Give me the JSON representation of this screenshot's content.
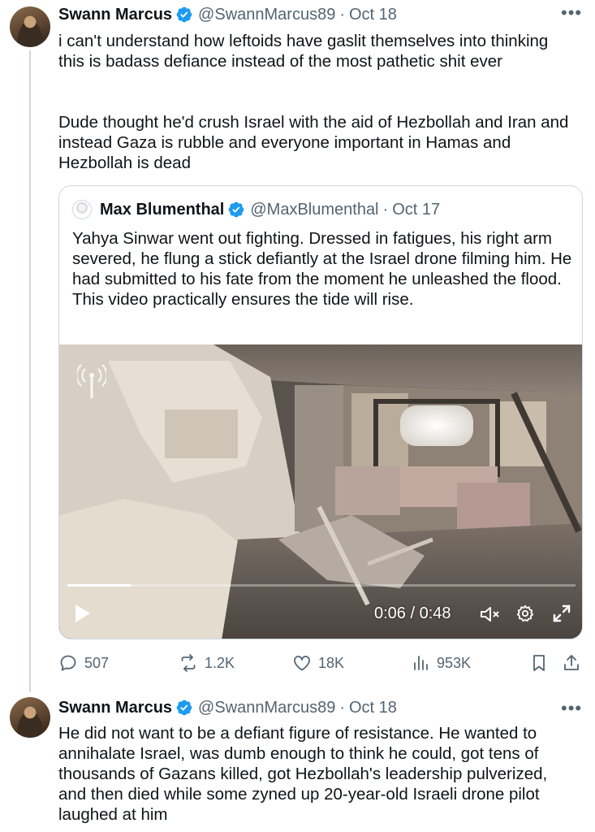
{
  "tweet1": {
    "author_name": "Swann Marcus",
    "handle": "@SwannMarcus89",
    "separator": "·",
    "date": "Oct 18",
    "paragraph1": "i can't understand how leftoids have gaslit themselves into thinking this is badass defiance instead of the most pathetic shit ever",
    "paragraph2": "Dude thought he'd crush Israel with the aid of Hezbollah and Iran and instead Gaza is rubble and everyone important in Hamas and Hezbollah is dead",
    "more_glyph": "•••"
  },
  "quote": {
    "author_name": "Max Blumenthal",
    "handle": "@MaxBlumenthal",
    "separator": "·",
    "date": "Oct 17",
    "text": "Yahya Sinwar went out fighting. Dressed in fatigues, his right arm severed, he flung a stick defiantly at the Israel drone filming him. He had submitted to his fate from the moment he unleashed the flood. This video practically ensures the tide will rise.",
    "video": {
      "timecode": "0:06 / 0:48",
      "progress_fraction": 0.125
    }
  },
  "actions": {
    "replies": "507",
    "retweets": "1.2K",
    "likes": "18K",
    "views": "953K"
  },
  "tweet2": {
    "author_name": "Swann Marcus",
    "handle": "@SwannMarcus89",
    "separator": "·",
    "date": "Oct 18",
    "text": "He did not want to be a defiant figure of resistance. He wanted to annihalate Israel, was dumb enough to think he could, got tens of thousands of Gazans killed, got Hezbollah's leadership pulverized, and then died while some zyned up 20-year-old Israeli drone pilot laughed at him",
    "more_glyph": "•••"
  },
  "colors": {
    "verified_blue": "#1d9bf0",
    "secondary_text": "#536471",
    "border": "#cfd9de"
  }
}
